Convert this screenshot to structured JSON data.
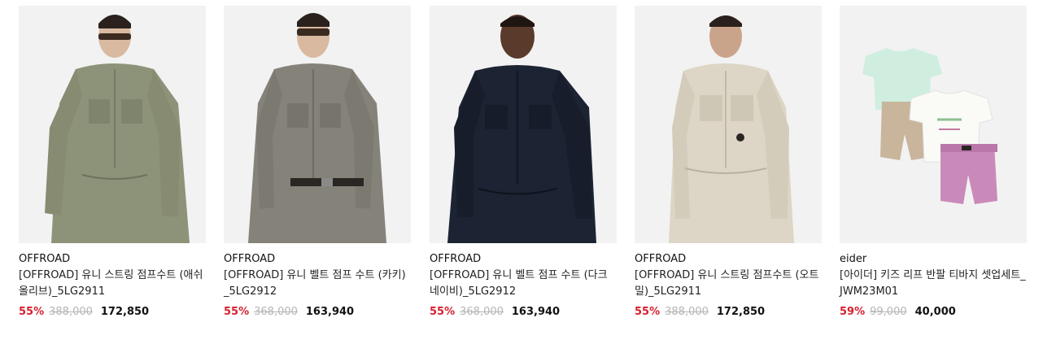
{
  "products": [
    {
      "brand": "OFFROAD",
      "name": "[OFFROAD] 유니 스트링 점프수트 (애쉬올리브)_5LG2911",
      "discount": "55%",
      "original_price": "388,000",
      "price": "172,850",
      "garment_color": "#8d9379"
    },
    {
      "brand": "OFFROAD",
      "name": "[OFFROAD] 유니 벨트 점프 수트 (카키)_5LG2912",
      "discount": "55%",
      "original_price": "368,000",
      "price": "163,940",
      "garment_color": "#85827a"
    },
    {
      "brand": "OFFROAD",
      "name": "[OFFROAD] 유니 벨트 점프 수트 (다크네이비)_5LG2912",
      "discount": "55%",
      "original_price": "368,000",
      "price": "163,940",
      "garment_color": "#1c2333"
    },
    {
      "brand": "OFFROAD",
      "name": "[OFFROAD] 유니 스트링 점프수트 (오트밀)_5LG2911",
      "discount": "55%",
      "original_price": "388,000",
      "price": "172,850",
      "garment_color": "#ddd6c6"
    },
    {
      "brand": "eider",
      "name": "[아이더] 키즈 리프 반팔 티바지 셋업세트_JWM23M01",
      "discount": "59%",
      "original_price": "99,000",
      "price": "40,000",
      "garment_color": "#cfeee0"
    }
  ],
  "colors": {
    "discount": "#d6202e",
    "original_price": "#b5b5b5",
    "thumb_bg": "#f2f2f2"
  }
}
